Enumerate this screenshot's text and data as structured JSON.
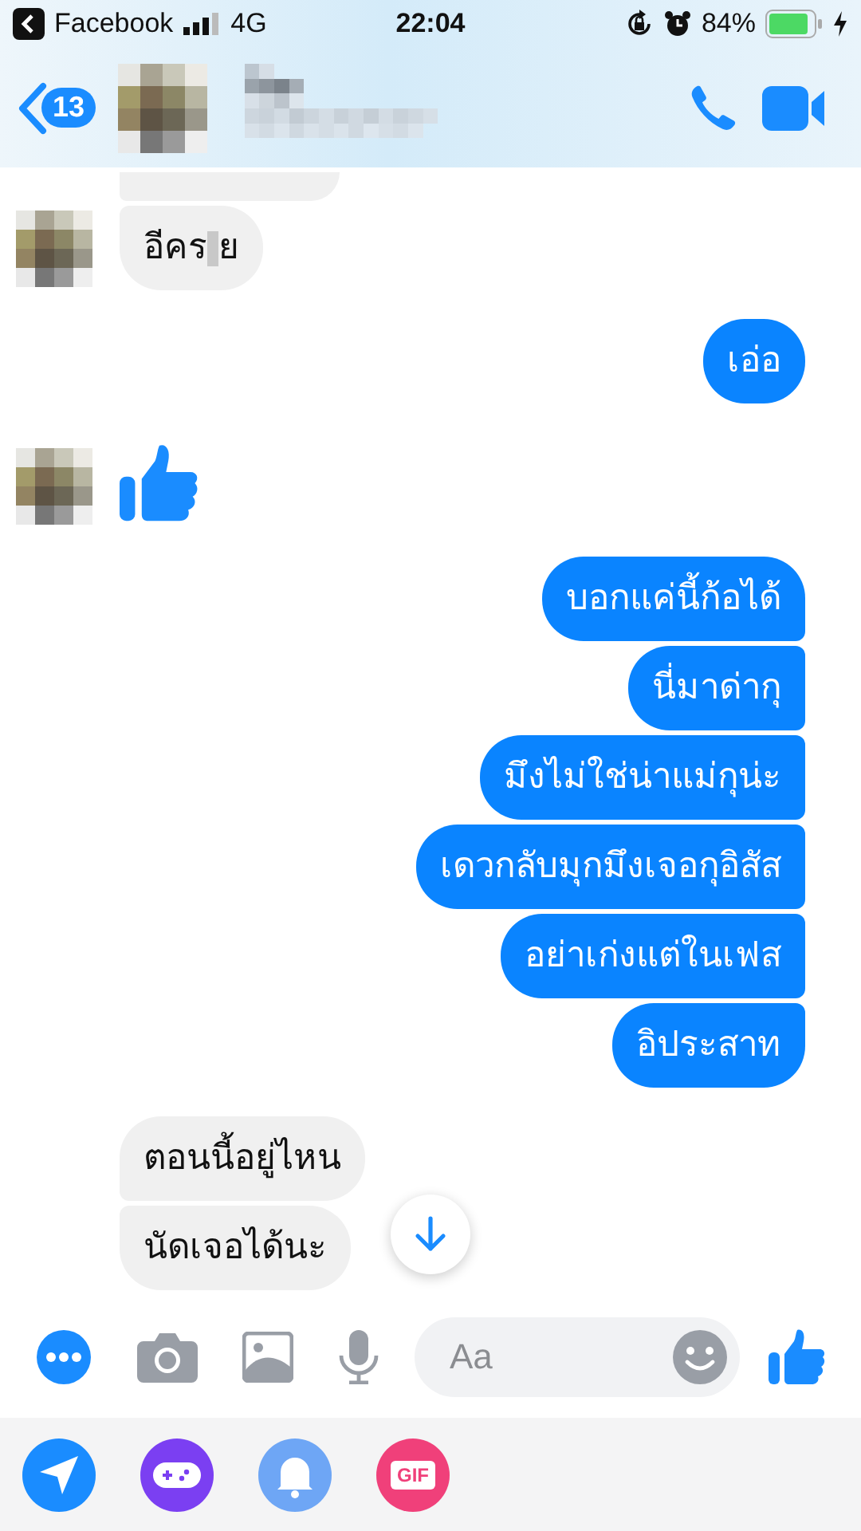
{
  "status_bar": {
    "back_app": "Facebook",
    "network": "4G",
    "time": "22:04",
    "battery": "84%"
  },
  "header": {
    "unread_count": "13"
  },
  "messages": [
    {
      "outgoing": false,
      "kind": "cut",
      "avatar": false
    },
    {
      "outgoing": false,
      "kind": "censored",
      "parts": [
        "อีคร",
        "ย"
      ],
      "avatar": true
    },
    {
      "outgoing": true,
      "kind": "text",
      "text": "เอ่อ"
    },
    {
      "outgoing": false,
      "kind": "like",
      "avatar": true
    },
    {
      "outgoing": true,
      "kind": "text",
      "text": "บอกแค่นี้ก้อได้"
    },
    {
      "outgoing": true,
      "kind": "text",
      "text": "นี่มาด่ากุ"
    },
    {
      "outgoing": true,
      "kind": "text",
      "text": "มึงไม่ใช่น่าแม่กุน่ะ"
    },
    {
      "outgoing": true,
      "kind": "text",
      "text": "เดวกลับมุกมึงเจอกุอิสัส"
    },
    {
      "outgoing": true,
      "kind": "text",
      "text": "อย่าเก่งแต่ในเฟส"
    },
    {
      "outgoing": true,
      "kind": "text",
      "text": "อิประสาท"
    },
    {
      "outgoing": false,
      "kind": "text",
      "text": "ตอนนี้อยู่ไหน",
      "avatar": false
    },
    {
      "outgoing": false,
      "kind": "text",
      "text": "นัดเจอได้นะ",
      "avatar": false
    }
  ],
  "composer": {
    "placeholder": "Aa"
  },
  "apps": [
    {
      "kind": "location"
    },
    {
      "kind": "games"
    },
    {
      "kind": "reminder"
    },
    {
      "kind": "gif",
      "label": "GIF"
    }
  ]
}
